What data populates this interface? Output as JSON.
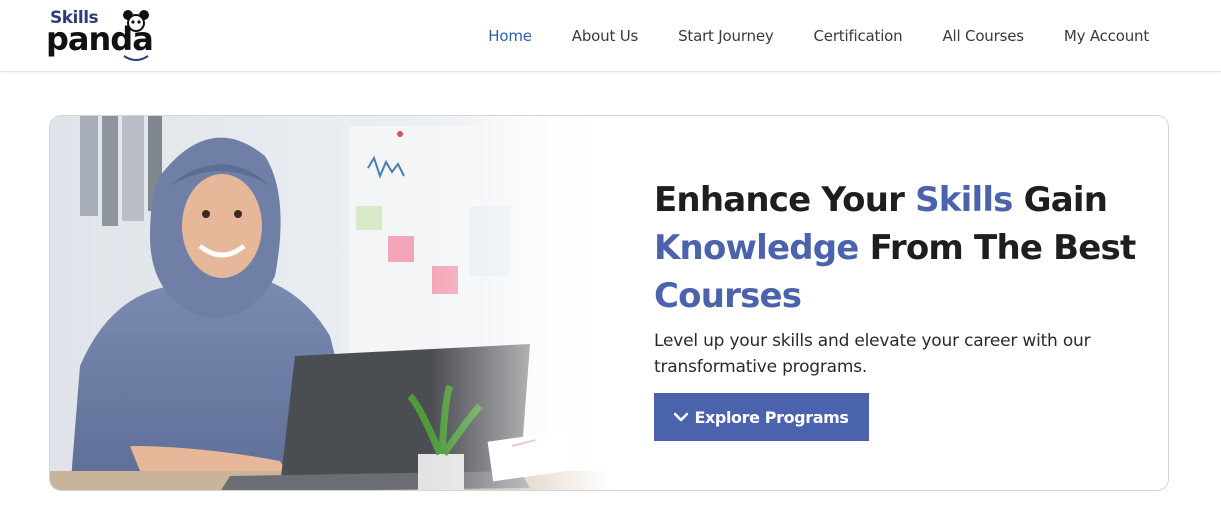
{
  "brand": {
    "logo_top": "Skills",
    "logo_bottom": "panda"
  },
  "nav": {
    "items": [
      {
        "label": "Home",
        "active": true
      },
      {
        "label": "About Us",
        "active": false
      },
      {
        "label": "Start Journey",
        "active": false
      },
      {
        "label": "Certification",
        "active": false
      },
      {
        "label": "All Courses",
        "active": false
      },
      {
        "label": "My Account",
        "active": false
      }
    ]
  },
  "hero": {
    "headline": {
      "part1": "Enhance Your ",
      "hl1": "Skills",
      "part2": " Gain ",
      "hl2": "Knowledge",
      "part3": " From The Best ",
      "hl3": "Courses"
    },
    "subtext": "Level up your skills and elevate your career with our transformative programs.",
    "cta_label": "Explore Programs",
    "cta_icon": "chevron-down-icon",
    "image_subject": "woman-with-laptop-photo"
  },
  "colors": {
    "accent": "#4b62ac",
    "nav_active": "#2b62a8",
    "text": "#1e1e1e"
  }
}
